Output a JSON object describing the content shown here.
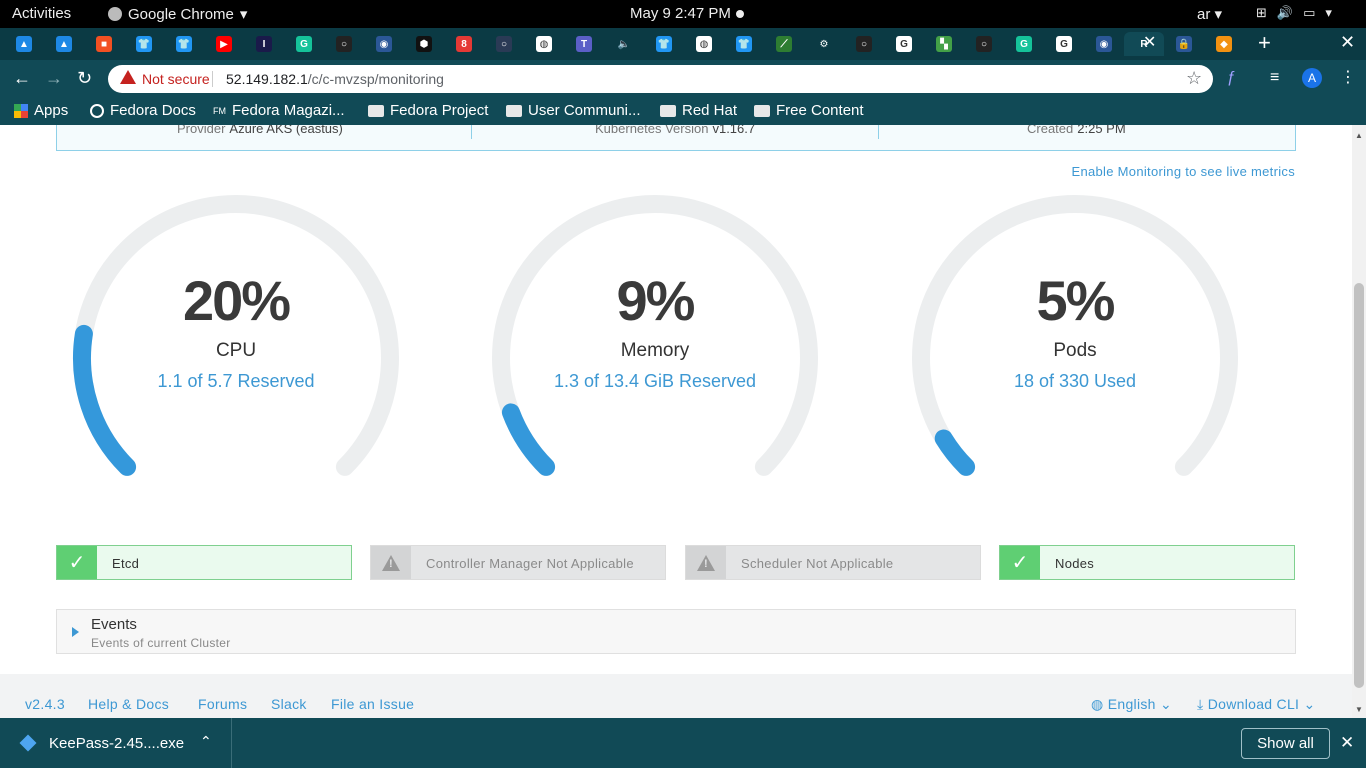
{
  "topbar": {
    "activities": "Activities",
    "app_name": "Google Chrome",
    "clock": "May 9   2:47 PM",
    "input_lang": "ar"
  },
  "tabs": [
    {
      "icon": "azure-icon",
      "color": "#1e88e5",
      "glyph": "▲"
    },
    {
      "icon": "azure-icon",
      "color": "#1e88e5",
      "glyph": "▲"
    },
    {
      "icon": "microsoft-icon",
      "color": "#f25022",
      "glyph": "■"
    },
    {
      "icon": "tshirt-icon",
      "color": "#2196f3",
      "glyph": "👕"
    },
    {
      "icon": "tshirt-icon",
      "color": "#2196f3",
      "glyph": "👕"
    },
    {
      "icon": "youtube-icon",
      "color": "#ff0000",
      "glyph": "▶"
    },
    {
      "icon": "i-icon",
      "color": "#1a1a4a",
      "glyph": "I"
    },
    {
      "icon": "grammarly-icon",
      "color": "#15c39a",
      "glyph": "G"
    },
    {
      "icon": "github-icon",
      "color": "#222222",
      "glyph": "○"
    },
    {
      "icon": "keepass-icon",
      "color": "#2b5797",
      "glyph": "◉"
    },
    {
      "icon": "hex-icon",
      "color": "#111111",
      "glyph": "⬢"
    },
    {
      "icon": "number-8-icon",
      "color": "#e53935",
      "glyph": "8"
    },
    {
      "icon": "circle-icon",
      "color": "#2a3a55",
      "glyph": "○"
    },
    {
      "icon": "globe-icon",
      "color": "#ffffff",
      "glyph": "◍"
    },
    {
      "icon": "teams-icon",
      "color": "#5b5fc7",
      "glyph": "T"
    },
    {
      "icon": "audio-icon",
      "color": "#0b3a44",
      "glyph": "🔈"
    },
    {
      "icon": "tshirt-icon",
      "color": "#2196f3",
      "glyph": "👕"
    },
    {
      "icon": "globe-icon",
      "color": "#ffffff",
      "glyph": "◍"
    },
    {
      "icon": "tshirt-icon",
      "color": "#2196f3",
      "glyph": "👕"
    },
    {
      "icon": "leaf-icon",
      "color": "#2e7d32",
      "glyph": "⟋"
    },
    {
      "icon": "gear-icon",
      "color": "#0b3a44",
      "glyph": "⚙"
    },
    {
      "icon": "github-icon",
      "color": "#222222",
      "glyph": "○"
    },
    {
      "icon": "google-icon",
      "color": "#ffffff",
      "glyph": "G"
    },
    {
      "icon": "layers-icon",
      "color": "#43a047",
      "glyph": "▚"
    },
    {
      "icon": "github-icon",
      "color": "#222222",
      "glyph": "○"
    },
    {
      "icon": "grammarly-icon",
      "color": "#15c39a",
      "glyph": "G"
    },
    {
      "icon": "google-icon",
      "color": "#ffffff",
      "glyph": "G"
    },
    {
      "icon": "keepass-icon",
      "color": "#2b5797",
      "glyph": "◉"
    },
    {
      "icon": "rancher-icon",
      "color": "#114a56",
      "glyph": "R"
    },
    {
      "icon": "lock-icon",
      "color": "#2b5797",
      "glyph": "🔒"
    },
    {
      "icon": "diamond-icon",
      "color": "#f29111",
      "glyph": "◆"
    }
  ],
  "address": {
    "not_secure": "Not secure",
    "host": "52.149.182.1",
    "path": "/c/c-mvzsp/monitoring"
  },
  "bookmarks": [
    "Apps",
    "Fedora Docs",
    "Fedora Magazi...",
    "Fedora Project",
    "User Communi...",
    "Red Hat",
    "Free Content"
  ],
  "cluster_info": {
    "provider_label": "Provider",
    "provider_value": "Azure AKS (eastus)",
    "k8s_label": "Kubernetes Version",
    "k8s_value": "v1.16.7",
    "created_label": "Created",
    "created_value": "2:25 PM"
  },
  "enable_monitoring": "Enable Monitoring to see live metrics",
  "gauges": [
    {
      "percent_text": "20%",
      "percent": 20,
      "label": "CPU",
      "detail": "1.1 of 5.7 Reserved"
    },
    {
      "percent_text": "9%",
      "percent": 9,
      "label": "Memory",
      "detail": "1.3 of 13.4 GiB Reserved"
    },
    {
      "percent_text": "5%",
      "percent": 5,
      "label": "Pods",
      "detail": "18 of 330 Used"
    }
  ],
  "colors": {
    "gauge_fill": "#3498db",
    "gauge_track": "#eceeef",
    "accent": "#3d98d3"
  },
  "components": [
    {
      "label": "Etcd",
      "status": "ok"
    },
    {
      "label": "Controller Manager Not Applicable",
      "status": "na"
    },
    {
      "label": "Scheduler Not Applicable",
      "status": "na"
    },
    {
      "label": "Nodes",
      "status": "ok"
    }
  ],
  "events": {
    "title": "Events",
    "description": "Events of current Cluster"
  },
  "footer": {
    "version": "v2.4.3",
    "help": "Help & Docs",
    "forums": "Forums",
    "slack": "Slack",
    "issue": "File an Issue",
    "language": "English",
    "download_cli": "Download CLI"
  },
  "downloads": {
    "file": "KeePass-2.45....exe",
    "show_all": "Show all"
  }
}
